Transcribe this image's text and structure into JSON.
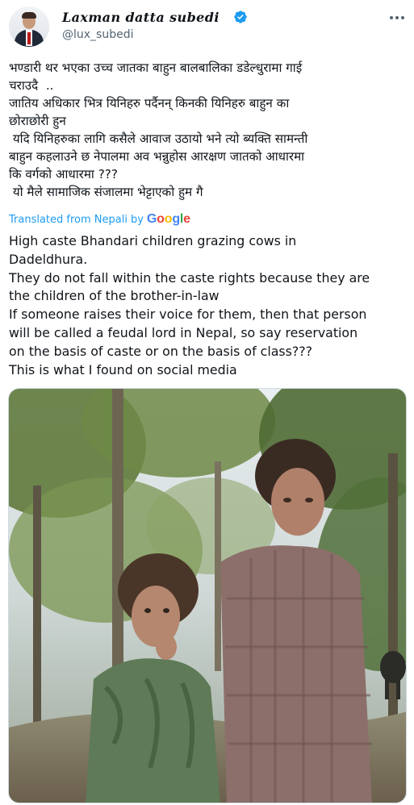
{
  "author": {
    "name": "Laxman datta subedi",
    "handle": "@lux_subedi"
  },
  "tweet": {
    "original_text": "भण्डारी थर भएका उच्च जातका बाहुन बालबालिका डडेल्धुरामा गाई\nचराउदै  ..\nजातिय अधिकार भित्र यिनिहरु पर्दैनन् किनकी यिनिहरु बाहुन का\nछोराछोरी हुन\n यदि यिनिहरुका लागि कसैले आवाज उठायो भने त्यो ब्यक्ति सामन्ती\nबाहुन कहलाउने छ नेपालमा अव भन्नुहोस आरक्षण जातको आधारमा\nकि वर्गको आधारमा ???\n यो मैले सामाजिक संजालमा भेट्टाएको हुम गै",
    "translated_label": "Translated from Nepali",
    "translated_by": "by",
    "translator": "Google",
    "translated_text": "High caste Bhandari children grazing cows in\nDadeldhura.\nThey do not fall within the caste rights because they are\nthe children of the brother-in-law\nIf someone raises their voice for them, then that person\nwill be called a feudal lord in Nepal, so say reservation\non the basis of caste or on the basis of class???\nThis is what I found on social media"
  },
  "icons": {
    "verified": "verified-badge-icon",
    "more": "more-options-icon"
  },
  "colors": {
    "link": "#1d9bf0",
    "secondary_text": "#536471",
    "verified": "#1d9bf0",
    "google_blue": "#4285F4",
    "google_red": "#EA4335",
    "google_yellow": "#FBBC05",
    "google_green": "#34A853"
  }
}
